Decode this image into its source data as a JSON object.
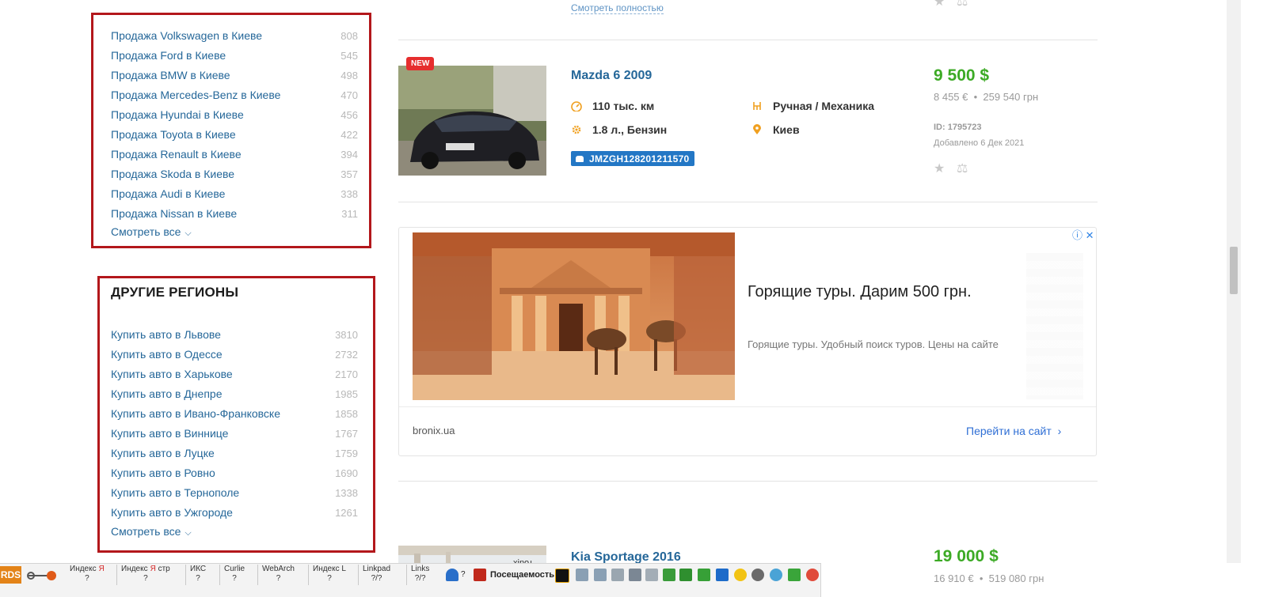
{
  "brands": {
    "items": [
      {
        "label": "Продажа Volkswagen в Киеве",
        "count": "808"
      },
      {
        "label": "Продажа Ford в Киеве",
        "count": "545"
      },
      {
        "label": "Продажа BMW в Киеве",
        "count": "498"
      },
      {
        "label": "Продажа Mercedes-Benz в Киеве",
        "count": "470"
      },
      {
        "label": "Продажа Hyundai в Киеве",
        "count": "456"
      },
      {
        "label": "Продажа Toyota в Киеве",
        "count": "422"
      },
      {
        "label": "Продажа Renault в Киеве",
        "count": "394"
      },
      {
        "label": "Продажа Skoda в Киеве",
        "count": "357"
      },
      {
        "label": "Продажа Audi в Киеве",
        "count": "338"
      },
      {
        "label": "Продажа Nissan в Киеве",
        "count": "311"
      }
    ],
    "see_all": "Смотреть все"
  },
  "regions": {
    "title": "ДРУГИЕ РЕГИОНЫ",
    "items": [
      {
        "label": "Купить авто в Львове",
        "count": "3810"
      },
      {
        "label": "Купить авто в Одессе",
        "count": "2732"
      },
      {
        "label": "Купить авто в Харькове",
        "count": "2170"
      },
      {
        "label": "Купить авто в Днепре",
        "count": "1985"
      },
      {
        "label": "Купить авто в Ивано-Франковске",
        "count": "1858"
      },
      {
        "label": "Купить авто в Виннице",
        "count": "1767"
      },
      {
        "label": "Купить авто в Луцке",
        "count": "1759"
      },
      {
        "label": "Купить авто в Ровно",
        "count": "1690"
      },
      {
        "label": "Купить авто в Тернополе",
        "count": "1338"
      },
      {
        "label": "Купить авто в Ужгороде",
        "count": "1261"
      }
    ],
    "see_all": "Смотреть все"
  },
  "listing_top": {
    "see_full": "Смотреть полностью"
  },
  "listing1": {
    "badge": "NEW",
    "title": "Mazda 6 2009",
    "mileage": "110 тыс. км",
    "gearbox": "Ручная / Механика",
    "engine": "1.8 л., Бензин",
    "city": "Киев",
    "vin": "JMZGH128201211570",
    "price": "9 500 $",
    "price_eur": "8 455 €",
    "price_uah": "259 540 грн",
    "dot": "•",
    "id": "ID: 1795723",
    "added": "Добавлено 6 Дек 2021"
  },
  "ad": {
    "headline": "Горящие туры. Дарим 500 грн.",
    "description": "Горящие туры. Удобный поиск туров. Цены на сайте",
    "domain": "bronix.ua",
    "cta": "Перейти на сайт",
    "cta_chevron": "›",
    "info_icons": "ⓘ ✕"
  },
  "listing2": {
    "title": "Kia Sportage 2016",
    "price": "19 000 $",
    "price_eur": "16 910 €",
    "price_uah": "519 080 грн",
    "dot": "•",
    "photo_watermark": "xinoɹ"
  },
  "toolbar": {
    "rds": "RDS",
    "items": [
      {
        "label": "Индекс",
        "accent": "Я",
        "sub": "?"
      },
      {
        "label": "Индекс",
        "accent": "Я",
        "suffix": " стр",
        "sub": "?"
      },
      {
        "label": "ИКС",
        "sub": "?"
      },
      {
        "label": "Curlie",
        "sub": "?"
      },
      {
        "label": "WebArch",
        "sub": "?"
      },
      {
        "label": "Индекс L",
        "sub": "?"
      },
      {
        "label": "Linkpad",
        "sub": "?/?"
      },
      {
        "label": "Links",
        "sub": "?/?"
      }
    ],
    "spy_q": "?",
    "visits": "Посещаемость"
  },
  "colors": {
    "accent_link": "#256799",
    "price_green": "#3caa25",
    "highlight_box": "#b3171b",
    "vin_blue": "#2377c5"
  }
}
